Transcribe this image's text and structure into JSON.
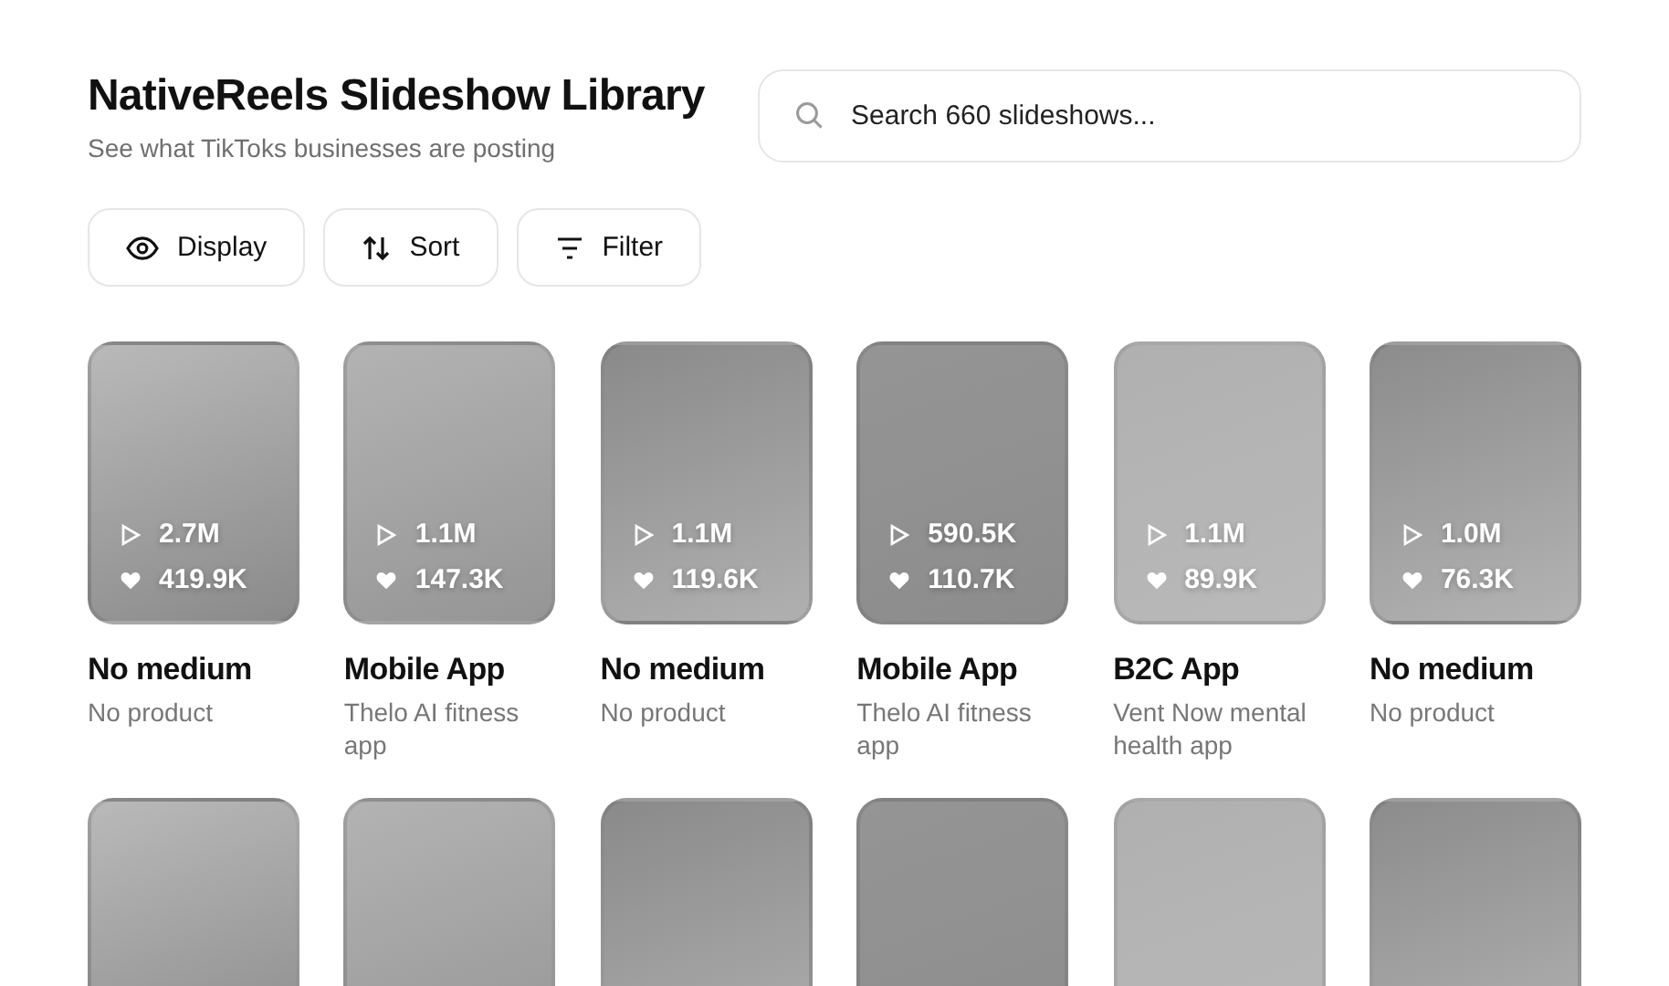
{
  "header": {
    "title": "NativeReels Slideshow Library",
    "subtitle": "See what TikToks businesses are posting"
  },
  "search": {
    "placeholder": "Search 660 slideshows..."
  },
  "toolbar": [
    {
      "kind": "display",
      "label": "Display"
    },
    {
      "kind": "sort",
      "label": "Sort"
    },
    {
      "kind": "filter",
      "label": "Filter"
    }
  ],
  "slideshows": [
    {
      "cut_off": false,
      "views": "2.7M",
      "likes": "419.9K",
      "medium": "No medium",
      "product": "No product"
    },
    {
      "cut_off": false,
      "views": "1.1M",
      "likes": "147.3K",
      "medium": "Mobile App",
      "product": "Thelo AI fitness app"
    },
    {
      "cut_off": false,
      "views": "1.1M",
      "likes": "119.6K",
      "medium": "No medium",
      "product": "No product"
    },
    {
      "cut_off": false,
      "views": "590.5K",
      "likes": "110.7K",
      "medium": "Mobile App",
      "product": "Thelo AI fitness app"
    },
    {
      "cut_off": false,
      "views": "1.1M",
      "likes": "89.9K",
      "medium": "B2C App",
      "product": "Vent Now mental health app"
    },
    {
      "cut_off": false,
      "views": "1.0M",
      "likes": "76.3K",
      "medium": "No medium",
      "product": "No product"
    },
    {
      "cut_off": true
    },
    {
      "cut_off": true
    },
    {
      "cut_off": true
    },
    {
      "cut_off": true
    },
    {
      "cut_off": true
    },
    {
      "cut_off": true
    }
  ]
}
